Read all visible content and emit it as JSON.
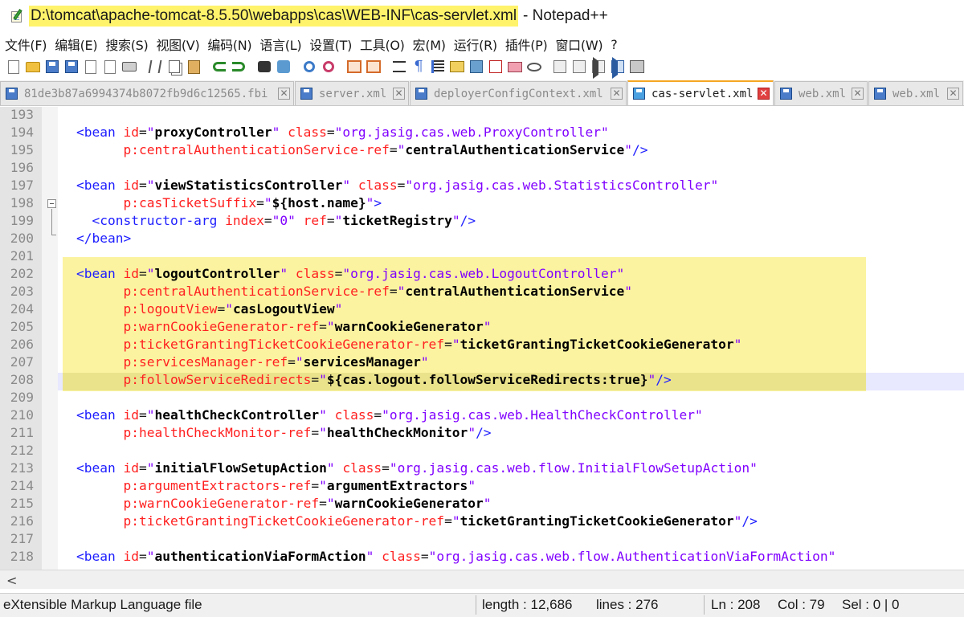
{
  "window": {
    "title_path": "D:\\tomcat\\apache-tomcat-8.5.50\\webapps\\cas\\WEB-INF\\cas-servlet.xml",
    "title_app": "- Notepad++"
  },
  "menu": [
    "文件(F)",
    "编辑(E)",
    "搜索(S)",
    "视图(V)",
    "编码(N)",
    "语言(L)",
    "设置(T)",
    "工具(O)",
    "宏(M)",
    "运行(R)",
    "插件(P)",
    "窗口(W)",
    "?"
  ],
  "tabs": [
    {
      "label": "81de3b87a6994374b8072fb9d6c12565.fbi",
      "active": false
    },
    {
      "label": "server.xml",
      "active": false
    },
    {
      "label": "deployerConfigContext.xml",
      "active": false
    },
    {
      "label": "cas-servlet.xml",
      "active": true
    },
    {
      "label": "web.xml",
      "active": false
    },
    {
      "label": "web.xml",
      "active": false
    }
  ],
  "tab_close_glyph": "✕",
  "code_lines": [
    {
      "n": "193",
      "tokens": []
    },
    {
      "n": "194",
      "tokens": [
        [
          "t",
          "<bean "
        ],
        [
          "a",
          "id"
        ],
        [
          "e",
          "="
        ],
        [
          "s",
          "\""
        ],
        [
          "v",
          "proxyController"
        ],
        [
          "s",
          "\" "
        ],
        [
          "a",
          "class"
        ],
        [
          "e",
          "="
        ],
        [
          "s",
          "\"org.jasig.cas.web.ProxyController\""
        ]
      ]
    },
    {
      "n": "195",
      "tokens": [
        [
          "a",
          "      p:centralAuthenticationService-ref"
        ],
        [
          "e",
          "="
        ],
        [
          "s",
          "\""
        ],
        [
          "v",
          "centralAuthenticationService"
        ],
        [
          "s",
          "\""
        ],
        [
          "t",
          "/>"
        ]
      ]
    },
    {
      "n": "196",
      "tokens": []
    },
    {
      "n": "197",
      "tokens": [
        [
          "t",
          "<bean "
        ],
        [
          "a",
          "id"
        ],
        [
          "e",
          "="
        ],
        [
          "s",
          "\""
        ],
        [
          "v",
          "viewStatisticsController"
        ],
        [
          "s",
          "\" "
        ],
        [
          "a",
          "class"
        ],
        [
          "e",
          "="
        ],
        [
          "s",
          "\"org.jasig.cas.web.StatisticsController\""
        ]
      ]
    },
    {
      "n": "198",
      "tokens": [
        [
          "a",
          "      p:casTicketSuffix"
        ],
        [
          "e",
          "="
        ],
        [
          "s",
          "\""
        ],
        [
          "v",
          "${host.name}"
        ],
        [
          "s",
          "\""
        ],
        [
          "t",
          ">"
        ]
      ]
    },
    {
      "n": "199",
      "tokens": [
        [
          "t",
          "  <constructor-arg "
        ],
        [
          "a",
          "index"
        ],
        [
          "e",
          "="
        ],
        [
          "s",
          "\"0\" "
        ],
        [
          "a",
          "ref"
        ],
        [
          "e",
          "="
        ],
        [
          "s",
          "\""
        ],
        [
          "v",
          "ticketRegistry"
        ],
        [
          "s",
          "\""
        ],
        [
          "t",
          "/>"
        ]
      ]
    },
    {
      "n": "200",
      "tokens": [
        [
          "t",
          "</bean>"
        ]
      ]
    },
    {
      "n": "201",
      "tokens": []
    },
    {
      "n": "202",
      "tokens": [
        [
          "t",
          "<bean "
        ],
        [
          "a",
          "id"
        ],
        [
          "e",
          "="
        ],
        [
          "s",
          "\""
        ],
        [
          "v",
          "logoutController"
        ],
        [
          "s",
          "\" "
        ],
        [
          "a",
          "class"
        ],
        [
          "e",
          "="
        ],
        [
          "s",
          "\"org.jasig.cas.web.LogoutController\""
        ]
      ]
    },
    {
      "n": "203",
      "tokens": [
        [
          "a",
          "      p:centralAuthenticationService-ref"
        ],
        [
          "e",
          "="
        ],
        [
          "s",
          "\""
        ],
        [
          "v",
          "centralAuthenticationService"
        ],
        [
          "s",
          "\""
        ]
      ]
    },
    {
      "n": "204",
      "tokens": [
        [
          "a",
          "      p:logoutView"
        ],
        [
          "e",
          "="
        ],
        [
          "s",
          "\""
        ],
        [
          "v",
          "casLogoutView"
        ],
        [
          "s",
          "\""
        ]
      ]
    },
    {
      "n": "205",
      "tokens": [
        [
          "a",
          "      p:warnCookieGenerator-ref"
        ],
        [
          "e",
          "="
        ],
        [
          "s",
          "\""
        ],
        [
          "v",
          "warnCookieGenerator"
        ],
        [
          "s",
          "\""
        ]
      ]
    },
    {
      "n": "206",
      "tokens": [
        [
          "a",
          "      p:ticketGrantingTicketCookieGenerator-ref"
        ],
        [
          "e",
          "="
        ],
        [
          "s",
          "\""
        ],
        [
          "v",
          "ticketGrantingTicketCookieGenerator"
        ],
        [
          "s",
          "\""
        ]
      ]
    },
    {
      "n": "207",
      "tokens": [
        [
          "a",
          "      p:servicesManager-ref"
        ],
        [
          "e",
          "="
        ],
        [
          "s",
          "\""
        ],
        [
          "v",
          "servicesManager"
        ],
        [
          "s",
          "\""
        ]
      ]
    },
    {
      "n": "208",
      "tokens": [
        [
          "a",
          "      p:followServiceRedirects"
        ],
        [
          "e",
          "="
        ],
        [
          "s",
          "\""
        ],
        [
          "v",
          "${cas.logout.followServiceRedirects:true}"
        ],
        [
          "s",
          "\""
        ],
        [
          "t",
          "/>"
        ]
      ]
    },
    {
      "n": "209",
      "tokens": []
    },
    {
      "n": "210",
      "tokens": [
        [
          "t",
          "<bean "
        ],
        [
          "a",
          "id"
        ],
        [
          "e",
          "="
        ],
        [
          "s",
          "\""
        ],
        [
          "v",
          "healthCheckController"
        ],
        [
          "s",
          "\" "
        ],
        [
          "a",
          "class"
        ],
        [
          "e",
          "="
        ],
        [
          "s",
          "\"org.jasig.cas.web.HealthCheckController\""
        ]
      ]
    },
    {
      "n": "211",
      "tokens": [
        [
          "a",
          "      p:healthCheckMonitor-ref"
        ],
        [
          "e",
          "="
        ],
        [
          "s",
          "\""
        ],
        [
          "v",
          "healthCheckMonitor"
        ],
        [
          "s",
          "\""
        ],
        [
          "t",
          "/>"
        ]
      ]
    },
    {
      "n": "212",
      "tokens": []
    },
    {
      "n": "213",
      "tokens": [
        [
          "t",
          "<bean "
        ],
        [
          "a",
          "id"
        ],
        [
          "e",
          "="
        ],
        [
          "s",
          "\""
        ],
        [
          "v",
          "initialFlowSetupAction"
        ],
        [
          "s",
          "\" "
        ],
        [
          "a",
          "class"
        ],
        [
          "e",
          "="
        ],
        [
          "s",
          "\"org.jasig.cas.web.flow.InitialFlowSetupAction\""
        ]
      ]
    },
    {
      "n": "214",
      "tokens": [
        [
          "a",
          "      p:argumentExtractors-ref"
        ],
        [
          "e",
          "="
        ],
        [
          "s",
          "\""
        ],
        [
          "v",
          "argumentExtractors"
        ],
        [
          "s",
          "\""
        ]
      ]
    },
    {
      "n": "215",
      "tokens": [
        [
          "a",
          "      p:warnCookieGenerator-ref"
        ],
        [
          "e",
          "="
        ],
        [
          "s",
          "\""
        ],
        [
          "v",
          "warnCookieGenerator"
        ],
        [
          "s",
          "\""
        ]
      ]
    },
    {
      "n": "216",
      "tokens": [
        [
          "a",
          "      p:ticketGrantingTicketCookieGenerator-ref"
        ],
        [
          "e",
          "="
        ],
        [
          "s",
          "\""
        ],
        [
          "v",
          "ticketGrantingTicketCookieGenerator"
        ],
        [
          "s",
          "\""
        ],
        [
          "t",
          "/>"
        ]
      ]
    },
    {
      "n": "217",
      "tokens": []
    },
    {
      "n": "218",
      "tokens": [
        [
          "t",
          "<bean "
        ],
        [
          "a",
          "id"
        ],
        [
          "e",
          "="
        ],
        [
          "s",
          "\""
        ],
        [
          "v",
          "authenticationViaFormAction"
        ],
        [
          "s",
          "\" "
        ],
        [
          "a",
          "class"
        ],
        [
          "e",
          "="
        ],
        [
          "s",
          "\"org.jasig.cas.web.flow.AuthenticationViaFormAction\""
        ]
      ]
    }
  ],
  "scroll_left_glyph": "<",
  "status": {
    "file_type": "eXtensible Markup Language file",
    "length": "length : 12,686",
    "lines": "lines : 276",
    "ln": "Ln : 208",
    "col": "Col : 79",
    "sel": "Sel : 0 | 0"
  },
  "colors": {
    "tag": "#2020ff",
    "attribute": "#ff2020",
    "string": "#8000ff",
    "value": "#000000",
    "highlight": "#fbf3a0",
    "title_highlight": "#fff36b",
    "active_tab_accent": "#f5a623"
  },
  "toolbar_icons": [
    "new-file-icon",
    "open-file-icon",
    "save-icon",
    "save-all-icon",
    "close-icon",
    "close-all-icon",
    "print-icon",
    "cut-icon",
    "copy-icon",
    "paste-icon",
    "undo-icon",
    "redo-icon",
    "find-icon",
    "replace-icon",
    "zoom-in-icon",
    "zoom-out-icon",
    "sync-vertical-icon",
    "sync-horizontal-icon",
    "word-wrap-icon",
    "show-all-chars-icon",
    "indent-guide-icon",
    "user-language-icon",
    "document-map-icon",
    "function-list-icon",
    "folder-as-workspace-icon",
    "monitoring-icon",
    "record-macro-icon",
    "stop-record-icon",
    "playback-icon",
    "run-macro-multiple-icon",
    "save-macro-icon"
  ]
}
